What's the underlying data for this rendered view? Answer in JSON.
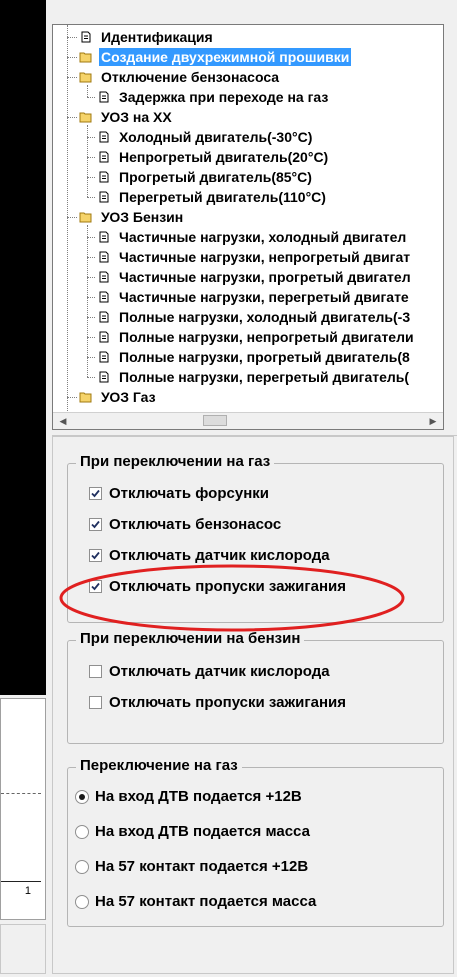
{
  "tree": {
    "items": [
      {
        "label": "Идентификация",
        "icon": "document-icon"
      },
      {
        "label": "Создание двухрежимной прошивки",
        "icon": "folder-icon",
        "selected": true
      },
      {
        "label": "Отключение бензонасоса",
        "icon": "folder-icon"
      },
      {
        "label": "Задержка при переходе на газ",
        "icon": "document-icon"
      },
      {
        "label": "УОЗ на ХХ",
        "icon": "folder-icon"
      },
      {
        "label": "Холодный двигатель(-30°C)",
        "icon": "document-icon"
      },
      {
        "label": "Непрогретый двигатель(20°C)",
        "icon": "document-icon"
      },
      {
        "label": "Прогретый двигатель(85°C)",
        "icon": "document-icon"
      },
      {
        "label": "Перегретый двигатель(110°C)",
        "icon": "document-icon"
      },
      {
        "label": "УОЗ Бензин",
        "icon": "folder-icon"
      },
      {
        "label": "Частичные нагрузки, холодный двигател",
        "icon": "document-icon"
      },
      {
        "label": "Частичные нагрузки, непрогретый двигат",
        "icon": "document-icon"
      },
      {
        "label": "Частичные нагрузки, прогретый двигател",
        "icon": "document-icon"
      },
      {
        "label": "Частичные нагрузки, перегретый двигате",
        "icon": "document-icon"
      },
      {
        "label": "Полные нагрузки, холодный двигатель(-3",
        "icon": "document-icon"
      },
      {
        "label": "Полные нагрузки, непрогретый двигатели",
        "icon": "document-icon"
      },
      {
        "label": "Полные нагрузки, прогретый двигатель(8",
        "icon": "document-icon"
      },
      {
        "label": "Полные нагрузки, перегретый двигатель(",
        "icon": "document-icon"
      },
      {
        "label": "УОЗ Газ",
        "icon": "folder-icon"
      }
    ]
  },
  "left_chart": {
    "tick_label": "1"
  },
  "gas_group": {
    "title": "При переключении на газ",
    "options": [
      {
        "label": "Отключать форсунки",
        "checked": true
      },
      {
        "label": "Отключать бензонасос",
        "checked": true
      },
      {
        "label": "Отключать датчик кислорода",
        "checked": true
      },
      {
        "label": "Отключать пропуски зажигания",
        "checked": true
      }
    ]
  },
  "petrol_group": {
    "title": "При переключении на бензин",
    "options": [
      {
        "label": "Отключать датчик кислорода",
        "checked": false
      },
      {
        "label": "Отключать пропуски зажигания",
        "checked": false
      }
    ]
  },
  "switch_group": {
    "title": "Переключение на газ",
    "options": [
      {
        "label": "На вход ДТВ подается +12В",
        "selected": true
      },
      {
        "label": "На вход ДТВ подается масса",
        "selected": false
      },
      {
        "label": "На 57 контакт подается +12В",
        "selected": false
      },
      {
        "label": "На 57 контакт подается масса",
        "selected": false
      }
    ]
  },
  "colors": {
    "selection": "#3399ff",
    "annotation": "#e02020"
  }
}
